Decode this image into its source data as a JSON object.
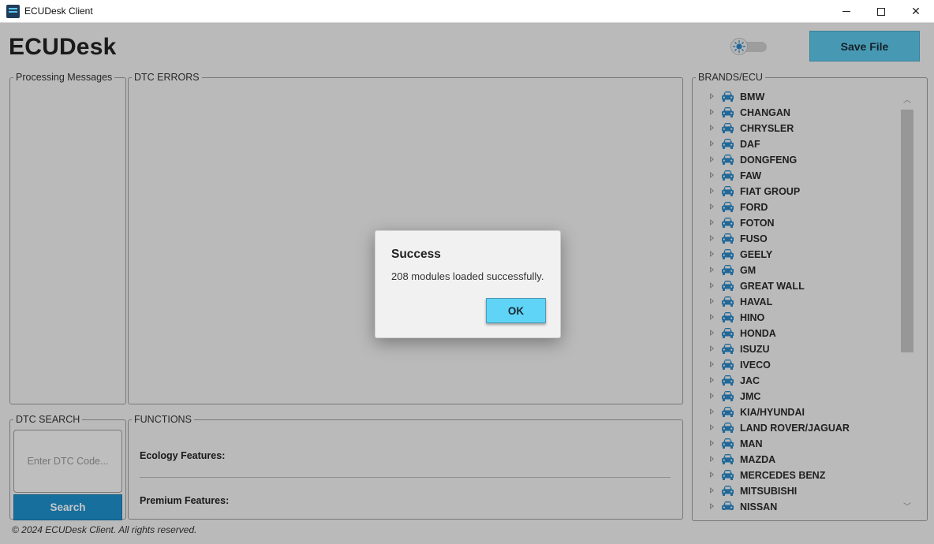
{
  "window": {
    "title": "ECUDesk Client",
    "icon": "app-icon",
    "controls": {
      "minimize": "minimize-icon",
      "maximize": "maximize-icon",
      "close": "✕"
    }
  },
  "header": {
    "brand": "ECUDesk",
    "theme_toggle_icon": "sun-icon",
    "theme_toggle_on": false,
    "save_label": "Save File"
  },
  "panels": {
    "processing_messages": "Processing Messages",
    "dtc_errors": "DTC ERRORS",
    "dtc_search": "DTC SEARCH",
    "functions": "FUNCTIONS",
    "brands": "BRANDS/ECU"
  },
  "dtc_search": {
    "placeholder": "Enter DTC Code...",
    "value": "",
    "button_label": "Search"
  },
  "functions": {
    "ecology_label": "Ecology Features:",
    "premium_label": "Premium Features:"
  },
  "brands": {
    "item_icon": "car-icon",
    "items": [
      {
        "label": "BMW"
      },
      {
        "label": "CHANGAN"
      },
      {
        "label": "CHRYSLER"
      },
      {
        "label": "DAF"
      },
      {
        "label": "DONGFENG"
      },
      {
        "label": "FAW"
      },
      {
        "label": "FIAT GROUP"
      },
      {
        "label": "FORD"
      },
      {
        "label": "FOTON"
      },
      {
        "label": "FUSO"
      },
      {
        "label": "GEELY"
      },
      {
        "label": "GM"
      },
      {
        "label": "GREAT WALL"
      },
      {
        "label": "HAVAL"
      },
      {
        "label": "HINO"
      },
      {
        "label": "HONDA"
      },
      {
        "label": "ISUZU"
      },
      {
        "label": "IVECO"
      },
      {
        "label": "JAC"
      },
      {
        "label": "JMC"
      },
      {
        "label": "KIA/HYUNDAI"
      },
      {
        "label": "LAND ROVER/JAGUAR"
      },
      {
        "label": "MAN"
      },
      {
        "label": "MAZDA"
      },
      {
        "label": "MERCEDES BENZ"
      },
      {
        "label": "MITSUBISHI"
      },
      {
        "label": "NISSAN"
      }
    ]
  },
  "footer": "© 2024 ECUDesk Client. All rights reserved.",
  "dialog": {
    "title": "Success",
    "message": "208 modules loaded successfully.",
    "ok_label": "OK"
  },
  "colors": {
    "accent": "#5bc4e6",
    "search_button": "#1e8fc9",
    "ok_button": "#5fd4f7",
    "car_icon": "#2a86c4"
  }
}
